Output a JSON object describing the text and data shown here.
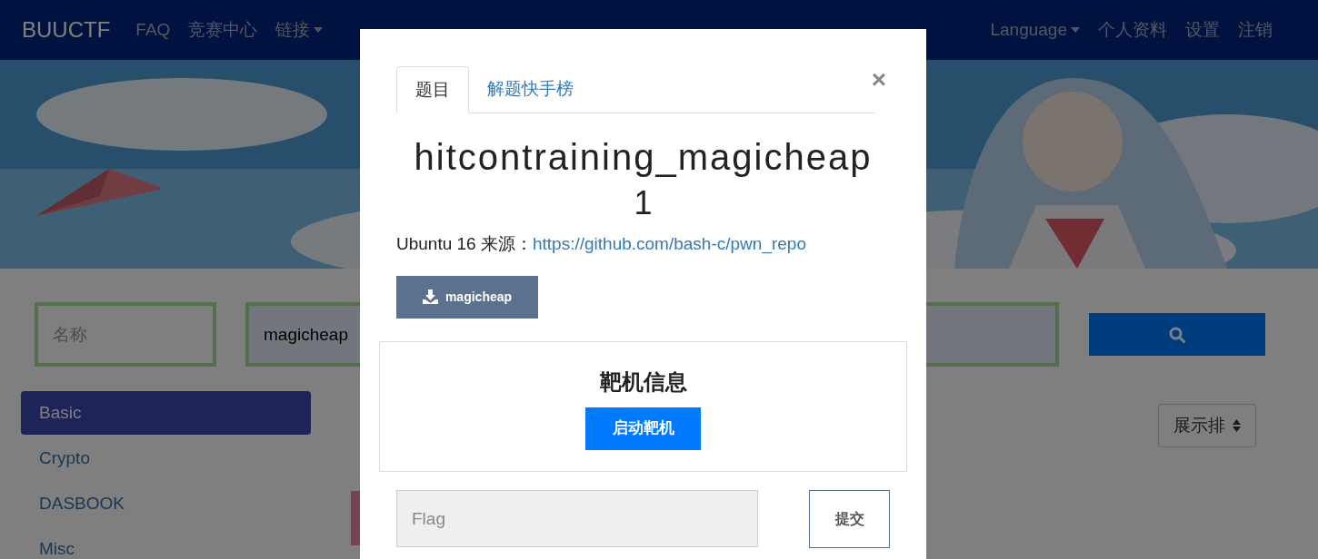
{
  "navbar": {
    "brand": "BUUCTF",
    "left_items": [
      {
        "label": "FAQ",
        "dropdown": false
      },
      {
        "label": "竞赛中心",
        "dropdown": false
      },
      {
        "label": "链接",
        "dropdown": true
      }
    ],
    "right_items": [
      {
        "label": "Language",
        "dropdown": true
      },
      {
        "label": "个人资料",
        "dropdown": false
      },
      {
        "label": "设置",
        "dropdown": false
      },
      {
        "label": "注销",
        "dropdown": false
      }
    ]
  },
  "search": {
    "name_placeholder": "名称",
    "query": "magicheap"
  },
  "categories": [
    {
      "label": "Basic",
      "selected": true
    },
    {
      "label": "Crypto",
      "selected": false
    },
    {
      "label": "DASBOOK",
      "selected": false
    },
    {
      "label": "Misc",
      "selected": false
    }
  ],
  "sort_button": "展示排",
  "modal": {
    "tabs": [
      {
        "label": "题目",
        "selected": true
      },
      {
        "label": "解题快手榜",
        "selected": false
      }
    ],
    "close": "×",
    "challenge_name": "hitcontraining_magicheap",
    "points": "1",
    "description": "Ubuntu 16 来源：",
    "link": "https://github.com/bash-c/pwn_repo",
    "download": "magicheap",
    "target_box": {
      "title": "靶机信息",
      "button": "启动靶机"
    },
    "flag_placeholder": "Flag",
    "submit": "提交"
  }
}
